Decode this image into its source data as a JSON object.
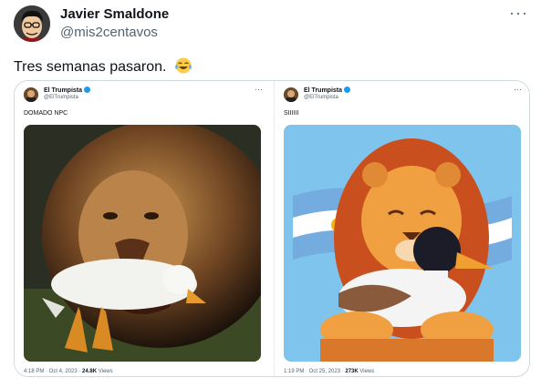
{
  "author": {
    "name": "Javier Smaldone",
    "handle": "@mis2centavos",
    "avatar_icon": "avatar-cartoon-icon"
  },
  "tweet": {
    "text": "Tres semanas pasaron.",
    "emoji_icon": "tears-of-joy-emoji-icon",
    "more_label": "···"
  },
  "media": {
    "left": {
      "name": "El Trumpista",
      "handle": "@ElTrumpista",
      "text": "DOMADO NPC",
      "meta_time": "4:18 PM · Oct 4, 2023 · ",
      "views_count": "24.8K",
      "views_label": " Views",
      "image_icon": "lion-eating-duck-image",
      "more_label": "···"
    },
    "right": {
      "name": "El Trumpista",
      "handle": "@ElTrumpista",
      "text": "SIIIIII",
      "meta_time": "1:19 PM · Oct 25, 2023 · ",
      "views_count": "273K",
      "views_label": " Views",
      "image_icon": "lion-hugging-duck-image",
      "more_label": "···"
    }
  },
  "colors": {
    "verified": "#1d9bf0",
    "secondary_text": "#536471",
    "border": "#cfd9de",
    "flag_blue": "#74acdf"
  }
}
